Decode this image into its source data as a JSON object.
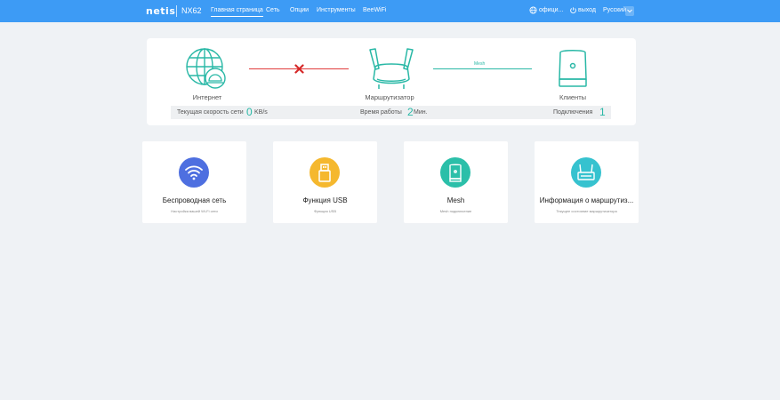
{
  "header": {
    "brand": "netis",
    "model": "NX62",
    "nav": [
      "Главная страница",
      "Сеть",
      "Опции",
      "Инструменты",
      "BeeWiFi"
    ],
    "active_nav": 0,
    "official_link": "офици...",
    "logout": "выход",
    "language": "Русский"
  },
  "status": {
    "internet_label": "Интернет",
    "router_label": "Маршрутизатор",
    "clients_label": "Клиенты",
    "mesh_label": "Mesh",
    "internet_connected": false,
    "speed_label": "Текущая скорость сети",
    "speed_value": "0",
    "speed_unit": "KB/s",
    "uptime_label": "Время работы",
    "uptime_value": "2",
    "uptime_unit": "Мин.",
    "connections_label": "Подключения",
    "connections_value": "1"
  },
  "cards": [
    {
      "title": "Беспроводная сеть",
      "subtitle": "Настройка вашей Wi-Fi сети",
      "color": "#4e6fe0",
      "icon": "wifi-icon"
    },
    {
      "title": "Функция USB",
      "subtitle": "Функция USB",
      "color": "#f5b82e",
      "icon": "usb-icon"
    },
    {
      "title": "Mesh",
      "subtitle": "Mesh подключение",
      "color": "#2bbfa9",
      "icon": "mesh-device-icon"
    },
    {
      "title": "Информация о маршрутиз...",
      "subtitle": "Текущее состояние маршрутизатора",
      "color": "#36c2cf",
      "icon": "router-icon"
    }
  ],
  "colors": {
    "header_bg": "#3d9bf5",
    "accent": "#29b8a6",
    "error": "#e03c3c"
  }
}
